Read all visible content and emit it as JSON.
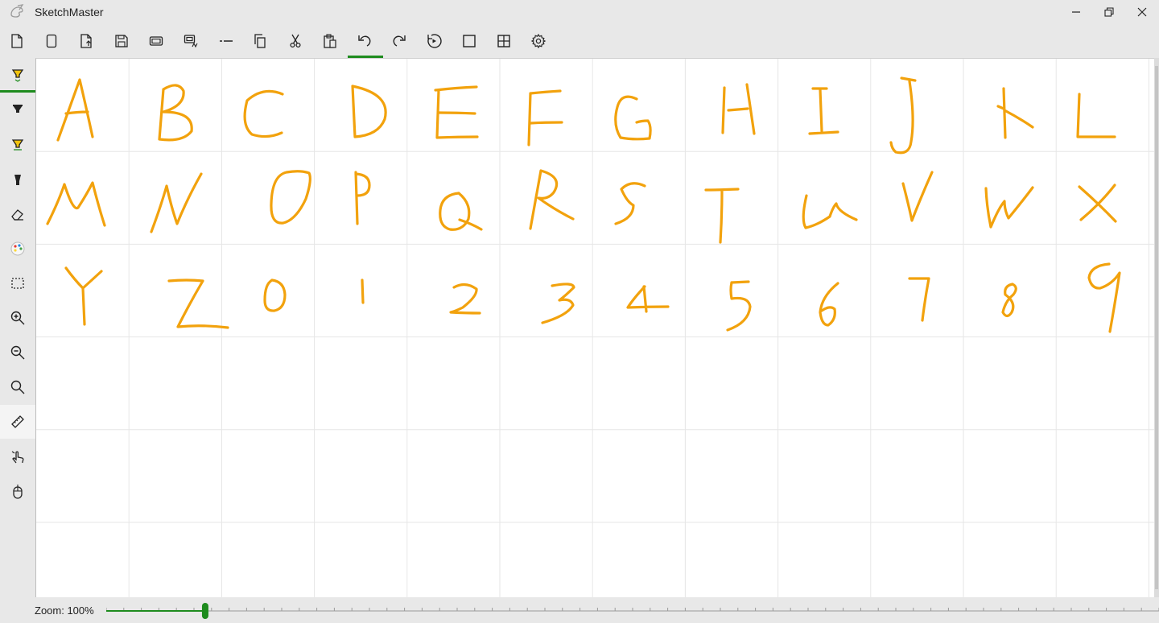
{
  "app": {
    "title": "SketchMaster",
    "accent_color": "#1e8b1e",
    "ink_color": "#f2a20d"
  },
  "window_controls": [
    {
      "name": "minimize-button",
      "icon": "minimize-icon"
    },
    {
      "name": "restore-button",
      "icon": "restore-icon"
    },
    {
      "name": "close-button",
      "icon": "close-icon"
    }
  ],
  "toolbar": {
    "items": [
      {
        "name": "new-button",
        "icon": "new-document-icon"
      },
      {
        "name": "blank-page-button",
        "icon": "page-icon"
      },
      {
        "name": "export-button",
        "icon": "export-document-icon"
      },
      {
        "name": "save-button",
        "icon": "save-icon"
      },
      {
        "name": "save-copy-button",
        "icon": "save-layers-icon"
      },
      {
        "name": "export-image-button",
        "icon": "save-image-icon"
      },
      {
        "name": "line-style-button",
        "icon": "dash-icon"
      },
      {
        "name": "copy-button",
        "icon": "copy-icon"
      },
      {
        "name": "cut-button",
        "icon": "scissors-icon"
      },
      {
        "name": "paste-button",
        "icon": "paste-icon"
      },
      {
        "name": "undo-button",
        "icon": "undo-icon",
        "active": true
      },
      {
        "name": "redo-button",
        "icon": "redo-icon"
      },
      {
        "name": "replay-button",
        "icon": "replay-icon"
      },
      {
        "name": "single-view-button",
        "icon": "square-icon"
      },
      {
        "name": "grid-view-button",
        "icon": "grid-icon"
      },
      {
        "name": "settings-button",
        "icon": "gear-icon"
      }
    ]
  },
  "sidebar": {
    "items": [
      {
        "name": "tool-selector-button",
        "icon": "highlighter-dropdown-icon",
        "active": true
      },
      {
        "name": "pen-button",
        "icon": "pen-icon"
      },
      {
        "name": "highlighter-button",
        "icon": "highlighter-icon"
      },
      {
        "name": "marker-button",
        "icon": "marker-icon"
      },
      {
        "name": "eraser-button",
        "icon": "eraser-icon"
      },
      {
        "name": "color-palette-button",
        "icon": "palette-icon"
      },
      {
        "name": "lasso-select-button",
        "icon": "lasso-select-icon"
      },
      {
        "name": "zoom-in-button",
        "icon": "zoom-in-icon"
      },
      {
        "name": "zoom-out-button",
        "icon": "zoom-out-icon"
      },
      {
        "name": "zoom-fit-button",
        "icon": "search-icon"
      },
      {
        "name": "ruler-button",
        "icon": "ruler-icon",
        "selected": true
      },
      {
        "name": "touch-mode-button",
        "icon": "touch-icon"
      },
      {
        "name": "mouse-mode-button",
        "icon": "mouse-icon"
      }
    ]
  },
  "canvas": {
    "grid_color": "#e6e6e6",
    "rows": 6,
    "columns": 12,
    "cells": [
      [
        "A",
        "B",
        "C",
        "D",
        "E",
        "F",
        "G",
        "H",
        "I",
        "J",
        "K",
        "L"
      ],
      [
        "M",
        "N",
        "O",
        "P",
        "Q",
        "R",
        "S",
        "T",
        "U",
        "V",
        "W",
        "X"
      ],
      [
        "Y",
        "Z",
        "0",
        "1",
        "2",
        "3",
        "4",
        "5",
        "6",
        "7",
        "8",
        "9"
      ]
    ]
  },
  "status": {
    "zoom_label": "Zoom: 100%",
    "zoom_percent": 100,
    "slider_fraction": 0.094
  }
}
